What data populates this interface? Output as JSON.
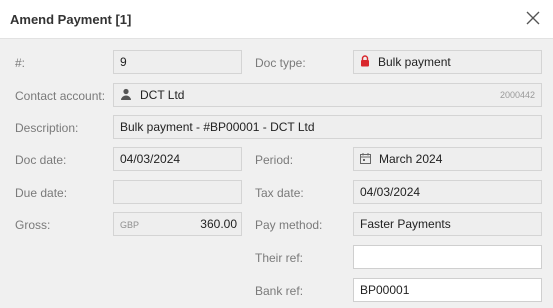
{
  "dialog": {
    "title": "Amend Payment [1]"
  },
  "labels": {
    "number": "#:",
    "contact_account": "Contact account:",
    "description": "Description:",
    "doc_date": "Doc date:",
    "due_date": "Due date:",
    "gross": "Gross:",
    "doc_type": "Doc type:",
    "period": "Period:",
    "tax_date": "Tax date:",
    "pay_method": "Pay method:",
    "their_ref": "Their ref:",
    "bank_ref": "Bank ref:"
  },
  "values": {
    "number": "9",
    "doc_type": "Bulk payment",
    "contact_account": "DCT Ltd",
    "contact_code": "2000442",
    "description": "Bulk payment - #BP00001 - DCT Ltd",
    "doc_date": "04/03/2024",
    "period": "March 2024",
    "due_date": "",
    "tax_date": "04/03/2024",
    "gross_currency": "GBP",
    "gross_amount": "360.00",
    "pay_method": "Faster Payments",
    "their_ref": "",
    "bank_ref": "BP00001"
  },
  "icons": {
    "close": "close-icon",
    "lock": "lock-icon",
    "person": "person-icon",
    "calendar": "calendar-icon"
  },
  "colors": {
    "lock": "#d9262c",
    "label": "#7a7a7a",
    "field_readonly": "#eeeeee",
    "field_editable": "#ffffff"
  }
}
